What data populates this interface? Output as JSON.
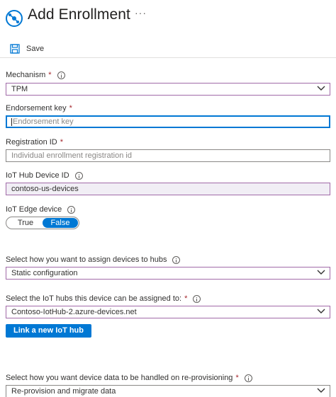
{
  "header": {
    "title": "Add Enrollment",
    "more": "···",
    "icon": "iot-hub-dps-icon"
  },
  "toolbar": {
    "save_label": "Save",
    "save_icon": "save-icon"
  },
  "fields": {
    "mechanism": {
      "label": "Mechanism",
      "required": "*",
      "value": "TPM"
    },
    "endorsement_key": {
      "label": "Endorsement key",
      "required": "*",
      "placeholder": "Endorsement key"
    },
    "registration_id": {
      "label": "Registration ID",
      "required": "*",
      "placeholder": "Individual enrollment registration id"
    },
    "iot_hub_device_id": {
      "label": "IoT Hub Device ID",
      "value": "contoso-us-devices"
    },
    "iot_edge_device": {
      "label": "IoT Edge device",
      "options": [
        "True",
        "False"
      ],
      "selected": "False"
    },
    "assign_policy": {
      "label": "Select how you want to assign devices to hubs",
      "value": "Static configuration"
    },
    "iot_hubs": {
      "label": "Select the IoT hubs this device can be assigned to:",
      "required": "*",
      "value": "Contoso-IotHub-2.azure-devices.net"
    },
    "link_hub_button": "Link a new IoT hub",
    "reprovision": {
      "label": "Select how you want device data to be handled on re-provisioning",
      "required": "*",
      "value": "Re-provision and migrate data"
    }
  },
  "colors": {
    "accent": "#0078d4",
    "required": "#a4262c",
    "highlight_border": "#a16aa8"
  }
}
